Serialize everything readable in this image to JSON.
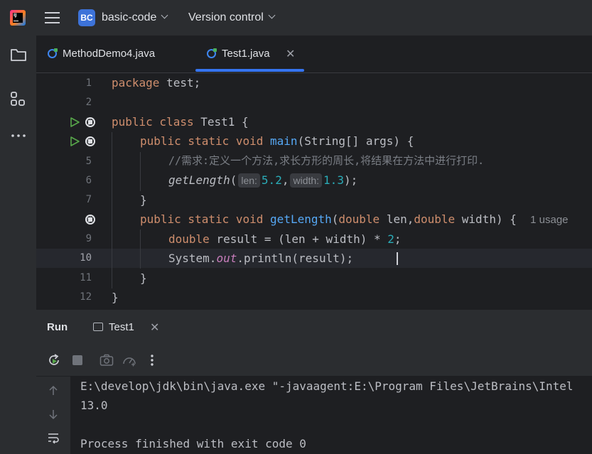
{
  "app": {
    "project_name": "basic-code",
    "project_badge": "BC",
    "vcs_menu": "Version control"
  },
  "tabs": [
    {
      "label": "MethodDemo4.java",
      "active": false
    },
    {
      "label": "Test1.java",
      "active": true
    }
  ],
  "editor": {
    "line_numbers": [
      "1",
      "2",
      "3",
      "4",
      "5",
      "6",
      "7",
      "8",
      "9",
      "10",
      "11",
      "12"
    ],
    "active_line": "10",
    "code": {
      "l1_kw": "package",
      "l1_rest": " test;",
      "l3_kw": "public class",
      "l3_rest": " Test1 {",
      "l4_kw": "public static void",
      "l4_fn": "main",
      "l4_rest": "(String[] args) {",
      "l5_comment": "//需求:定义一个方法,求长方形的周长,将结果在方法中进行打印.",
      "l6_fn": "getLength",
      "l6_open": "(",
      "l6_hint1": "len:",
      "l6_num1": "5.2",
      "l6_comma": ",",
      "l6_hint2": "width:",
      "l6_num2": "1.3",
      "l6_close": ");",
      "l7": "}",
      "l8_kw": "public static",
      "l8_kw2": "void",
      "l8_fn": "getLength",
      "l8_p1": "(",
      "l8_t1": "double",
      "l8_p2": " len,",
      "l8_t2": "double",
      "l8_p3": " width) {",
      "l8_usage": "1 usage",
      "l9_kw": "double",
      "l9_rest": " result = (len + width) * ",
      "l9_num": "2",
      "l9_end": ";",
      "l10_a": "System.",
      "l10_field": "out",
      "l10_b": ".println(result);",
      "l11": "}",
      "l12": "}"
    }
  },
  "run_panel": {
    "title": "Run",
    "tab_label": "Test1",
    "console_lines": [
      "E:\\develop\\jdk\\bin\\java.exe \"-javaagent:E:\\Program Files\\JetBrains\\Intel",
      "13.0",
      "",
      "Process finished with exit code 0"
    ]
  },
  "colors": {
    "accent": "#3574f0",
    "keyword": "#cf8e6d",
    "function": "#56a8f5",
    "number": "#2aacb8",
    "comment": "#7a7e85",
    "field": "#c77dbb"
  }
}
